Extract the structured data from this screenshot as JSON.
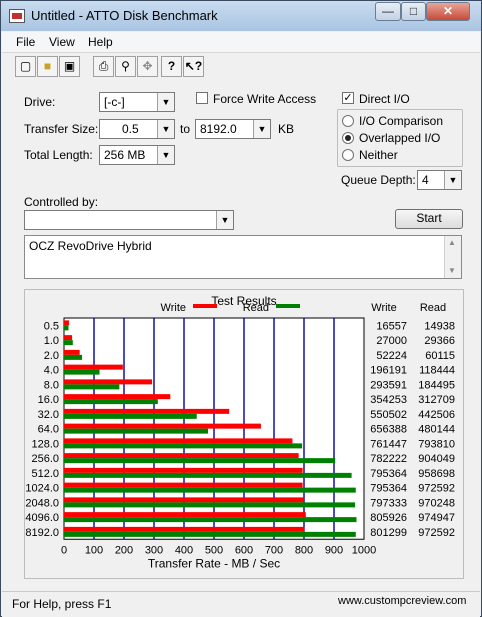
{
  "window": {
    "title": "Untitled - ATTO Disk Benchmark"
  },
  "titlebar_buttons": {
    "minimize": "—",
    "maximize": "□",
    "close": "✕"
  },
  "menu": [
    "File",
    "View",
    "Help"
  ],
  "toolbar": [
    "new-icon",
    "open-icon",
    "save-icon",
    "print-icon",
    "print-preview-icon",
    "move-icon",
    "help-icon",
    "context-help-icon"
  ],
  "form": {
    "drive_label": "Drive:",
    "drive_value": "[-c-]",
    "transfer_size_label": "Transfer Size:",
    "transfer_from": "0.5",
    "to_label": "to",
    "transfer_to": "8192.0",
    "kb_label": "KB",
    "total_length_label": "Total Length:",
    "total_length_value": "256 MB",
    "force_write_label": "Force Write Access",
    "direct_io_label": "Direct I/O",
    "io_comparison_label": "I/O Comparison",
    "overlapped_io_label": "Overlapped I/O",
    "neither_label": "Neither",
    "queue_depth_label": "Queue Depth:",
    "queue_depth_value": "4",
    "controlled_by_label": "Controlled by:",
    "controlled_by_value": "",
    "start_label": "Start",
    "description": "OCZ RevoDrive Hybrid"
  },
  "results": {
    "title": "Test Results",
    "legend_write": "Write",
    "legend_read": "Read",
    "col_write": "Write",
    "col_read": "Read"
  },
  "status": {
    "help": "For Help, press F1",
    "watermark": "www.custompcreview.com"
  },
  "colors": {
    "write": "#ff0000",
    "read": "#008000",
    "grid": "#0000a0"
  },
  "chart_data": {
    "type": "bar",
    "orientation": "horizontal",
    "categories": [
      "0.5",
      "1.0",
      "2.0",
      "4.0",
      "8.0",
      "16.0",
      "32.0",
      "64.0",
      "128.0",
      "256.0",
      "512.0",
      "1024.0",
      "2048.0",
      "4096.0",
      "8192.0"
    ],
    "series": [
      {
        "name": "Write",
        "values": [
          16557,
          27000,
          52224,
          196191,
          293591,
          354253,
          550502,
          656388,
          761447,
          782222,
          795364,
          795364,
          797333,
          805926,
          801299
        ]
      },
      {
        "name": "Read",
        "values": [
          14938,
          29366,
          60115,
          118444,
          184495,
          312709,
          442506,
          480144,
          793810,
          904049,
          958698,
          972592,
          970248,
          974947,
          972592
        ]
      }
    ],
    "xlabel": "Transfer Rate - MB / Sec",
    "xticks": [
      "0",
      "100",
      "200",
      "300",
      "400",
      "500",
      "600",
      "700",
      "800",
      "900",
      "1000"
    ],
    "xlim": [
      0,
      1000
    ],
    "grid": true
  }
}
